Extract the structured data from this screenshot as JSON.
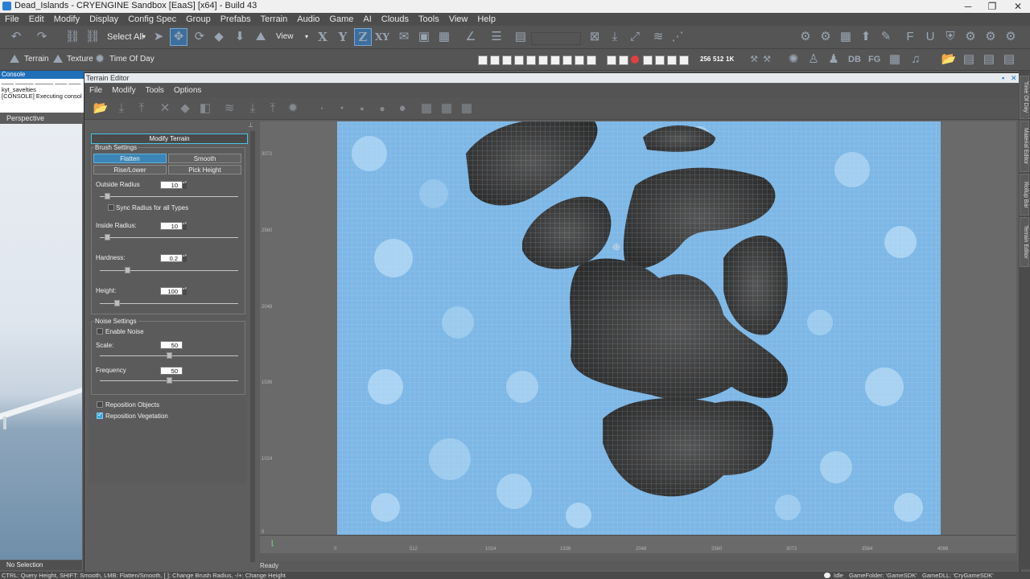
{
  "window": {
    "title": "Dead_Islands - CRYENGINE Sandbox [EaaS] [x64] - Build 43",
    "minimize": "─",
    "maximize": "❐",
    "close": "✕"
  },
  "menu": [
    "File",
    "Edit",
    "Modify",
    "Display",
    "Config Spec",
    "Group",
    "Prefabs",
    "Terrain",
    "Audio",
    "Game",
    "AI",
    "Clouds",
    "Tools",
    "View",
    "Help"
  ],
  "toolbar": {
    "select_all": "Select All",
    "view": "View",
    "axis_x": "X",
    "axis_y": "Y",
    "axis_z": "Z",
    "axis_xy": "XY",
    "res_256": "256",
    "res_512": "512",
    "res_1k": "1K",
    "db": "DB",
    "fg": "FG"
  },
  "toolbar2": {
    "terrain": "Terrain",
    "texture": "Texture",
    "time_of_day": "Time Of Day"
  },
  "console": {
    "title": "Console",
    "lines": [
      "—— ——— ——— —— ——",
      "kyt_savelties",
      "[CONSOLE] Executing console c"
    ]
  },
  "viewport": {
    "label": "Perspective",
    "no_selection": "No Selection"
  },
  "terrain_editor": {
    "title": "Terrain Editor",
    "menu": [
      "File",
      "Modify",
      "Tools",
      "Options"
    ],
    "modify_terrain": "Modify Terrain",
    "brush_settings": {
      "title": "Brush Settings",
      "flatten": "Flatten",
      "smooth": "Smooth",
      "rise_lower": "Rise/Lower",
      "pick_height": "Pick Height",
      "outside_radius_label": "Outside Radius",
      "outside_radius": "10",
      "outside_radius_pos": 0.05,
      "sync_radius": "Sync Radius for all Types",
      "inside_radius_label": "Inside Radius:",
      "inside_radius": "10",
      "inside_radius_pos": 0.05,
      "hardness_label": "Hardness:",
      "hardness": "0.2",
      "hardness_pos": 0.2,
      "height_label": "Height:",
      "height": "100",
      "height_pos": 0.12
    },
    "noise_settings": {
      "title": "Noise Settings",
      "enable_noise": "Enable Noise",
      "scale_label": "Scale:",
      "scale": "50",
      "scale_pos": 0.5,
      "frequency_label": "Frequency",
      "frequency": "50",
      "frequency_pos": 0.5
    },
    "reposition_objects": "Reposition Objects",
    "reposition_vegetation": "Reposition Vegetation",
    "status": "Ready",
    "vertical_ruler": [
      "3072",
      "2560",
      "2048",
      "1536",
      "1024",
      "0"
    ],
    "horizontal_ruler": [
      "0",
      "512",
      "1024",
      "1536",
      "2048",
      "2560",
      "3072",
      "3584",
      "4096"
    ]
  },
  "right_tabs": [
    "Time Of Day",
    "Material Editor",
    "Rollup Bar",
    "Terrain Editor"
  ],
  "statusbar": {
    "hint": "CTRL: Query Height, SHIFT: Smooth, LMB: Flatten/Smooth, [ ]: Change Brush Radius, -/+: Change Height",
    "state": "Idle",
    "game_folder": "GameFolder: 'GameSDK'",
    "game_dll": "GameDLL: 'CryGameSDK'"
  }
}
